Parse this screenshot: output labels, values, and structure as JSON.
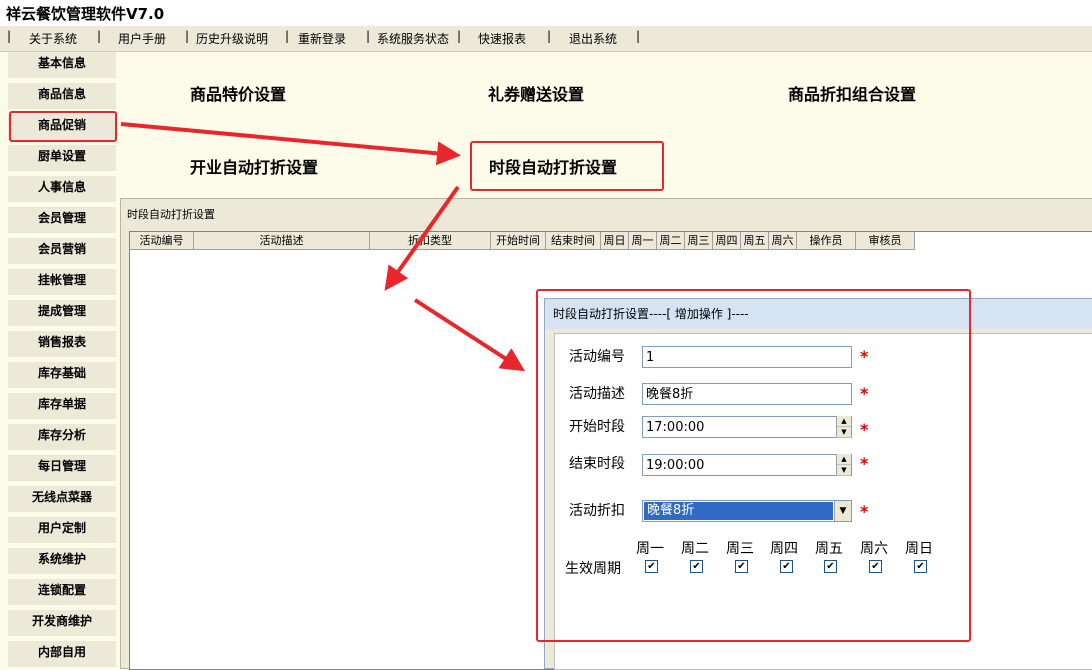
{
  "app": {
    "title": "祥云餐饮管理软件V7.0"
  },
  "menu": {
    "separator": "|",
    "items": [
      "关于系统",
      "用户手册",
      "历史升级说明",
      "重新登录",
      "系统服务状态",
      "快速报表",
      "退出系统"
    ]
  },
  "sidebar": {
    "items": [
      "基本信息",
      "商品信息",
      "商品促销",
      "厨单设置",
      "人事信息",
      "会员管理",
      "会员营销",
      "挂帐管理",
      "提成管理",
      "销售报表",
      "库存基础",
      "库存单据",
      "库存分析",
      "每日管理",
      "无线点菜器",
      "用户定制",
      "系统维护",
      "连锁配置",
      "开发商维护",
      "内部自用"
    ],
    "selected": "商品促销"
  },
  "links": {
    "special_price": "商品特价设置",
    "coupon_gift": "礼券赠送设置",
    "discount_combo": "商品折扣组合设置",
    "opening_discount": "开业自动打折设置",
    "period_discount": "时段自动打折设置"
  },
  "panel": {
    "title": "时段自动打折设置",
    "columns": [
      "活动编号",
      "活动描述",
      "折扣类型",
      "开始时间",
      "结束时间",
      "周日",
      "周一",
      "周二",
      "周三",
      "周四",
      "周五",
      "周六",
      "操作员",
      "审核员"
    ]
  },
  "dialog": {
    "title": "时段自动打折设置----[ 增加操作 ]----",
    "required_mark": "*",
    "fields": {
      "id_label": "活动编号",
      "id_value": "1",
      "desc_label": "活动描述",
      "desc_value": "晚餐8折",
      "start_label": "开始时段",
      "start_value": "17:00:00",
      "end_label": "结束时段",
      "end_value": "19:00:00",
      "discount_label": "活动折扣",
      "discount_value": "晚餐8折"
    },
    "week_label": "生效周期",
    "days": [
      "周一",
      "周二",
      "周三",
      "周四",
      "周五",
      "周六",
      "周日"
    ],
    "checked": [
      true,
      true,
      true,
      true,
      true,
      true,
      true
    ],
    "check_mark": "✔",
    "spin_up": "▲",
    "spin_down": "▼",
    "dropdown_arrow": "▼"
  },
  "colors": {
    "highlight_box": "#e8262b",
    "selection": "#316ac5"
  }
}
